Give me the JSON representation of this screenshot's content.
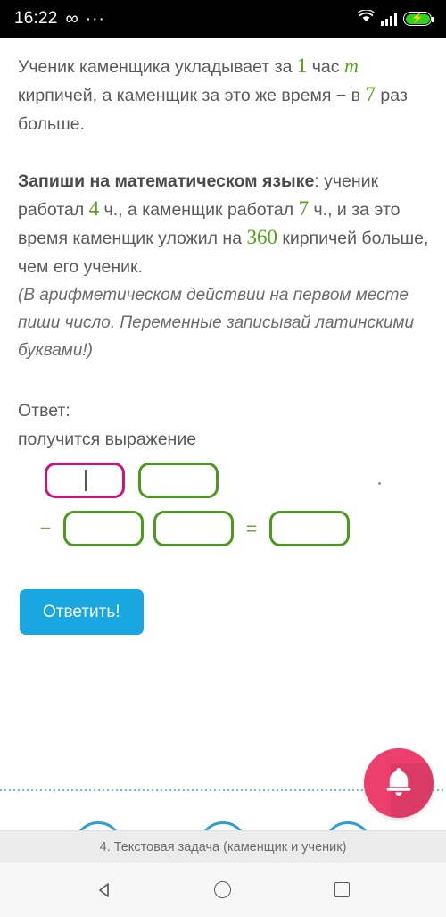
{
  "status_bar": {
    "clock": "16:22",
    "infinity_glyph": "∞",
    "dots_glyph": "···",
    "battery_bolt_glyph": "⚡",
    "icons": [
      "infinity-icon",
      "dots-icon",
      "wifi-icon",
      "signal-icon",
      "battery-charging-icon"
    ]
  },
  "problem": {
    "p1_a": "Ученик каменщика укладывает за ",
    "p1_n1": "1",
    "p1_b": " час ",
    "p1_var": "m",
    "p1_c": " кирпичей, а каменщик за это же время − в ",
    "p1_n2": "7",
    "p1_d": " раз больше.",
    "p2_bold": "Запиши на математическом языке",
    "p2_a": ": ученик работал ",
    "p2_n1": "4",
    "p2_b": " ч., а каменщик работал ",
    "p2_n2": "7",
    "p2_c": " ч., и за это время каменщик уложил на ",
    "p2_n3": "360",
    "p2_d": " кирпичей больше, чем его ученик.",
    "note": "(В арифметическом действии на первом месте пиши число. Переменные записывай латинскими буквами!)"
  },
  "answer": {
    "label": "Ответ:",
    "sublabel": "получится выражение",
    "minus_glyph": "−",
    "equals_glyph": "=",
    "fields": [
      {
        "name": "answer-field-1",
        "value": "",
        "focused": true,
        "color": "#cc1579"
      },
      {
        "name": "answer-field-2",
        "value": "",
        "focused": false,
        "color": "#4a9a1e"
      },
      {
        "name": "answer-field-3",
        "value": "",
        "focused": false,
        "color": "#4a9a1e"
      },
      {
        "name": "answer-field-4",
        "value": "",
        "focused": false,
        "color": "#4a9a1e"
      },
      {
        "name": "answer-field-5",
        "value": "",
        "focused": false,
        "color": "#4a9a1e"
      }
    ],
    "submit_label": "Ответить!"
  },
  "fab": {
    "icon": "bell-icon",
    "color": "#ec3f6e"
  },
  "bottom_bar": {
    "title": "4. Текстовая задача (каменщик и ученик)"
  },
  "nav_bar": {
    "back": "back-icon",
    "home": "home-icon",
    "recents": "recents-icon"
  },
  "colors": {
    "accent_green": "#4ea312",
    "accent_pink": "#cc1579",
    "accent_blue": "#18a7e0",
    "fab_pink": "#ec3f6e",
    "text_gray": "#5a5a5a"
  }
}
